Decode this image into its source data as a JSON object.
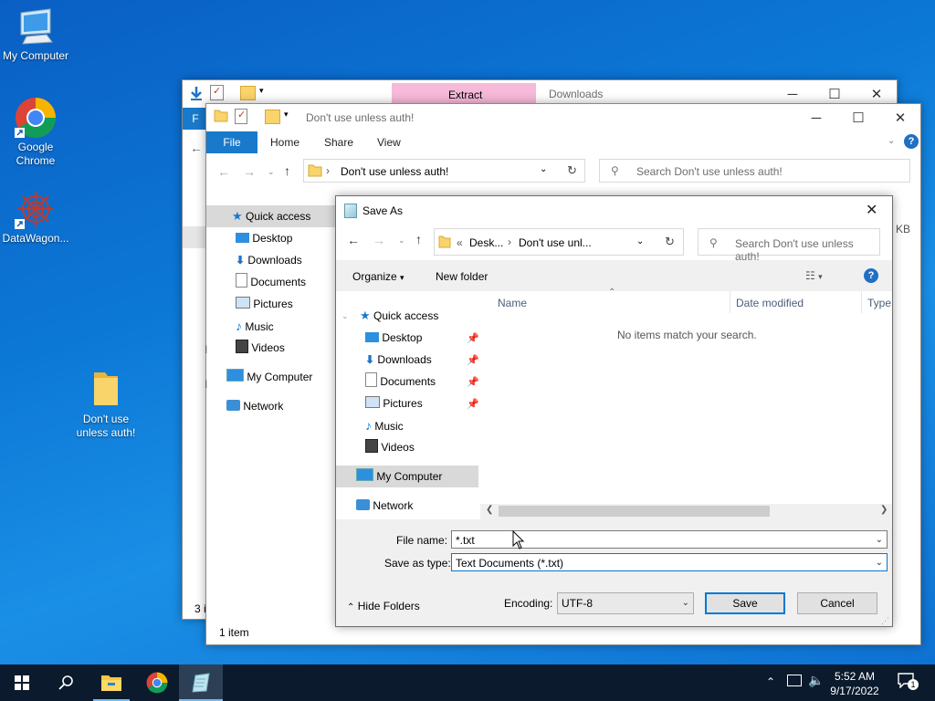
{
  "desktop": {
    "icons": [
      {
        "label": "My Computer"
      },
      {
        "label": "Google Chrome"
      },
      {
        "label": "DataWagon..."
      },
      {
        "label": "Don't use unless auth!"
      }
    ]
  },
  "window_downloads": {
    "ribbon_context_tab": "Extract",
    "title": "Downloads",
    "file_tab_partial": "F",
    "status_partial": "3 i"
  },
  "window_folder": {
    "title": "Don't use unless auth!",
    "tabs": [
      "File",
      "Home",
      "Share",
      "View"
    ],
    "address": "Don't use unless auth!",
    "search_placeholder": "Search Don't use unless auth!",
    "nav": [
      "Quick access",
      "Desktop",
      "Downloads",
      "Documents",
      "Pictures",
      "Music",
      "Videos",
      "My Computer",
      "Network"
    ],
    "partial_size": "KB",
    "status": "1 item",
    "accent": "#1979ca"
  },
  "save_dialog": {
    "title": "Save As",
    "breadcrumb_prefix": "«",
    "breadcrumb_1": "Desk...",
    "breadcrumb_2": "Don't use unl...",
    "search_placeholder": "Search Don't use unless auth!",
    "organize": "Organize",
    "new_folder": "New folder",
    "columns": [
      "Name",
      "Date modified",
      "Type"
    ],
    "empty_message": "No items match your search.",
    "nav": [
      {
        "label": "Quick access",
        "pinned": false
      },
      {
        "label": "Desktop",
        "pinned": true
      },
      {
        "label": "Downloads",
        "pinned": true
      },
      {
        "label": "Documents",
        "pinned": true
      },
      {
        "label": "Pictures",
        "pinned": true
      },
      {
        "label": "Music",
        "pinned": false
      },
      {
        "label": "Videos",
        "pinned": false
      },
      {
        "label": "My Computer",
        "pinned": false
      },
      {
        "label": "Network",
        "pinned": false
      }
    ],
    "file_name_label": "File name:",
    "file_name_value": "*.txt",
    "save_as_type_label": "Save as type:",
    "save_as_type_value": "Text Documents (*.txt)",
    "hide_folders": "Hide Folders",
    "encoding_label": "Encoding:",
    "encoding_value": "UTF-8",
    "save_button": "Save",
    "cancel_button": "Cancel"
  },
  "taskbar": {
    "time": "5:52 AM",
    "date": "9/17/2022",
    "notification_count": "1"
  }
}
